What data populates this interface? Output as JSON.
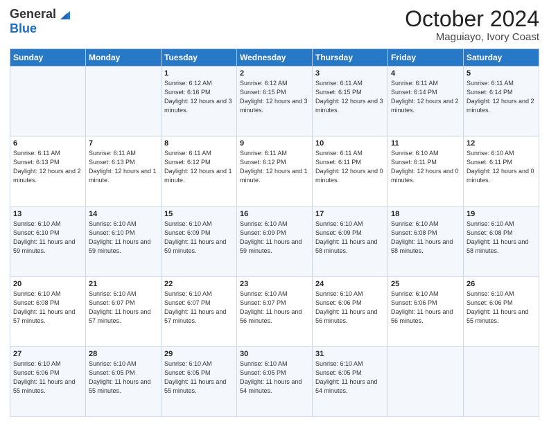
{
  "header": {
    "logo_general": "General",
    "logo_blue": "Blue",
    "month": "October 2024",
    "location": "Maguiayo, Ivory Coast"
  },
  "weekdays": [
    "Sunday",
    "Monday",
    "Tuesday",
    "Wednesday",
    "Thursday",
    "Friday",
    "Saturday"
  ],
  "weeks": [
    [
      {
        "day": "",
        "sunrise": "",
        "sunset": "",
        "daylight": ""
      },
      {
        "day": "",
        "sunrise": "",
        "sunset": "",
        "daylight": ""
      },
      {
        "day": "1",
        "sunrise": "Sunrise: 6:12 AM",
        "sunset": "Sunset: 6:16 PM",
        "daylight": "Daylight: 12 hours and 3 minutes."
      },
      {
        "day": "2",
        "sunrise": "Sunrise: 6:12 AM",
        "sunset": "Sunset: 6:15 PM",
        "daylight": "Daylight: 12 hours and 3 minutes."
      },
      {
        "day": "3",
        "sunrise": "Sunrise: 6:11 AM",
        "sunset": "Sunset: 6:15 PM",
        "daylight": "Daylight: 12 hours and 3 minutes."
      },
      {
        "day": "4",
        "sunrise": "Sunrise: 6:11 AM",
        "sunset": "Sunset: 6:14 PM",
        "daylight": "Daylight: 12 hours and 2 minutes."
      },
      {
        "day": "5",
        "sunrise": "Sunrise: 6:11 AM",
        "sunset": "Sunset: 6:14 PM",
        "daylight": "Daylight: 12 hours and 2 minutes."
      }
    ],
    [
      {
        "day": "6",
        "sunrise": "Sunrise: 6:11 AM",
        "sunset": "Sunset: 6:13 PM",
        "daylight": "Daylight: 12 hours and 2 minutes."
      },
      {
        "day": "7",
        "sunrise": "Sunrise: 6:11 AM",
        "sunset": "Sunset: 6:13 PM",
        "daylight": "Daylight: 12 hours and 1 minute."
      },
      {
        "day": "8",
        "sunrise": "Sunrise: 6:11 AM",
        "sunset": "Sunset: 6:12 PM",
        "daylight": "Daylight: 12 hours and 1 minute."
      },
      {
        "day": "9",
        "sunrise": "Sunrise: 6:11 AM",
        "sunset": "Sunset: 6:12 PM",
        "daylight": "Daylight: 12 hours and 1 minute."
      },
      {
        "day": "10",
        "sunrise": "Sunrise: 6:11 AM",
        "sunset": "Sunset: 6:11 PM",
        "daylight": "Daylight: 12 hours and 0 minutes."
      },
      {
        "day": "11",
        "sunrise": "Sunrise: 6:10 AM",
        "sunset": "Sunset: 6:11 PM",
        "daylight": "Daylight: 12 hours and 0 minutes."
      },
      {
        "day": "12",
        "sunrise": "Sunrise: 6:10 AM",
        "sunset": "Sunset: 6:11 PM",
        "daylight": "Daylight: 12 hours and 0 minutes."
      }
    ],
    [
      {
        "day": "13",
        "sunrise": "Sunrise: 6:10 AM",
        "sunset": "Sunset: 6:10 PM",
        "daylight": "Daylight: 11 hours and 59 minutes."
      },
      {
        "day": "14",
        "sunrise": "Sunrise: 6:10 AM",
        "sunset": "Sunset: 6:10 PM",
        "daylight": "Daylight: 11 hours and 59 minutes."
      },
      {
        "day": "15",
        "sunrise": "Sunrise: 6:10 AM",
        "sunset": "Sunset: 6:09 PM",
        "daylight": "Daylight: 11 hours and 59 minutes."
      },
      {
        "day": "16",
        "sunrise": "Sunrise: 6:10 AM",
        "sunset": "Sunset: 6:09 PM",
        "daylight": "Daylight: 11 hours and 59 minutes."
      },
      {
        "day": "17",
        "sunrise": "Sunrise: 6:10 AM",
        "sunset": "Sunset: 6:09 PM",
        "daylight": "Daylight: 11 hours and 58 minutes."
      },
      {
        "day": "18",
        "sunrise": "Sunrise: 6:10 AM",
        "sunset": "Sunset: 6:08 PM",
        "daylight": "Daylight: 11 hours and 58 minutes."
      },
      {
        "day": "19",
        "sunrise": "Sunrise: 6:10 AM",
        "sunset": "Sunset: 6:08 PM",
        "daylight": "Daylight: 11 hours and 58 minutes."
      }
    ],
    [
      {
        "day": "20",
        "sunrise": "Sunrise: 6:10 AM",
        "sunset": "Sunset: 6:08 PM",
        "daylight": "Daylight: 11 hours and 57 minutes."
      },
      {
        "day": "21",
        "sunrise": "Sunrise: 6:10 AM",
        "sunset": "Sunset: 6:07 PM",
        "daylight": "Daylight: 11 hours and 57 minutes."
      },
      {
        "day": "22",
        "sunrise": "Sunrise: 6:10 AM",
        "sunset": "Sunset: 6:07 PM",
        "daylight": "Daylight: 11 hours and 57 minutes."
      },
      {
        "day": "23",
        "sunrise": "Sunrise: 6:10 AM",
        "sunset": "Sunset: 6:07 PM",
        "daylight": "Daylight: 11 hours and 56 minutes."
      },
      {
        "day": "24",
        "sunrise": "Sunrise: 6:10 AM",
        "sunset": "Sunset: 6:06 PM",
        "daylight": "Daylight: 11 hours and 56 minutes."
      },
      {
        "day": "25",
        "sunrise": "Sunrise: 6:10 AM",
        "sunset": "Sunset: 6:06 PM",
        "daylight": "Daylight: 11 hours and 56 minutes."
      },
      {
        "day": "26",
        "sunrise": "Sunrise: 6:10 AM",
        "sunset": "Sunset: 6:06 PM",
        "daylight": "Daylight: 11 hours and 55 minutes."
      }
    ],
    [
      {
        "day": "27",
        "sunrise": "Sunrise: 6:10 AM",
        "sunset": "Sunset: 6:06 PM",
        "daylight": "Daylight: 11 hours and 55 minutes."
      },
      {
        "day": "28",
        "sunrise": "Sunrise: 6:10 AM",
        "sunset": "Sunset: 6:05 PM",
        "daylight": "Daylight: 11 hours and 55 minutes."
      },
      {
        "day": "29",
        "sunrise": "Sunrise: 6:10 AM",
        "sunset": "Sunset: 6:05 PM",
        "daylight": "Daylight: 11 hours and 55 minutes."
      },
      {
        "day": "30",
        "sunrise": "Sunrise: 6:10 AM",
        "sunset": "Sunset: 6:05 PM",
        "daylight": "Daylight: 11 hours and 54 minutes."
      },
      {
        "day": "31",
        "sunrise": "Sunrise: 6:10 AM",
        "sunset": "Sunset: 6:05 PM",
        "daylight": "Daylight: 11 hours and 54 minutes."
      },
      {
        "day": "",
        "sunrise": "",
        "sunset": "",
        "daylight": ""
      },
      {
        "day": "",
        "sunrise": "",
        "sunset": "",
        "daylight": ""
      }
    ]
  ]
}
